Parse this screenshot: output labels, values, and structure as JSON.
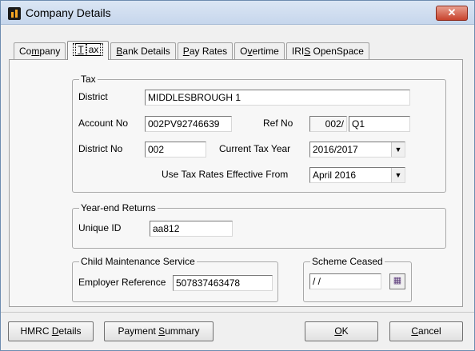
{
  "window": {
    "title": "Company Details",
    "close_label": "✕"
  },
  "tabs": [
    {
      "pre": "Co",
      "u": "m",
      "post": "pany"
    },
    {
      "pre": "",
      "u": "T",
      "post": "ax"
    },
    {
      "pre": "",
      "u": "B",
      "post": "ank Details"
    },
    {
      "pre": "",
      "u": "P",
      "post": "ay Rates"
    },
    {
      "pre": "O",
      "u": "v",
      "post": "ertime"
    },
    {
      "pre": "IRI",
      "u": "S",
      "post": " OpenSpace"
    }
  ],
  "tax": {
    "group_label": "Tax",
    "district_label": "District",
    "district_value": "MIDDLESBROUGH 1",
    "account_label": "Account No",
    "account_value": "002PV92746639",
    "ref_label": "Ref No",
    "ref_prefix": "002/",
    "ref_value": "Q1",
    "district_no_label": "District No",
    "district_no_value": "002",
    "current_year_label": "Current Tax Year",
    "current_year_value": "2016/2017",
    "rates_label": "Use Tax Rates Effective From",
    "rates_value": "April 2016"
  },
  "year_end": {
    "group_label": "Year-end Returns",
    "unique_label": "Unique ID",
    "unique_value": "aa812"
  },
  "child": {
    "group_label": "Child Maintenance Service",
    "employer_ref_label": "Employer Reference",
    "employer_ref_value": "507837463478"
  },
  "scheme": {
    "group_label": "Scheme Ceased",
    "date_value": " / /"
  },
  "buttons": {
    "hmrc": {
      "pre": "HMRC ",
      "u": "D",
      "post": "etails"
    },
    "payment": {
      "pre": "Payment ",
      "u": "S",
      "post": "ummary"
    },
    "ok": {
      "pre": "",
      "u": "O",
      "post": "K"
    },
    "cancel": {
      "pre": "",
      "u": "C",
      "post": "ancel"
    }
  },
  "icons": {
    "app": "app-icon",
    "close": "close-icon",
    "dropdown": "chevron-down-icon",
    "calendar": "calendar-icon"
  }
}
